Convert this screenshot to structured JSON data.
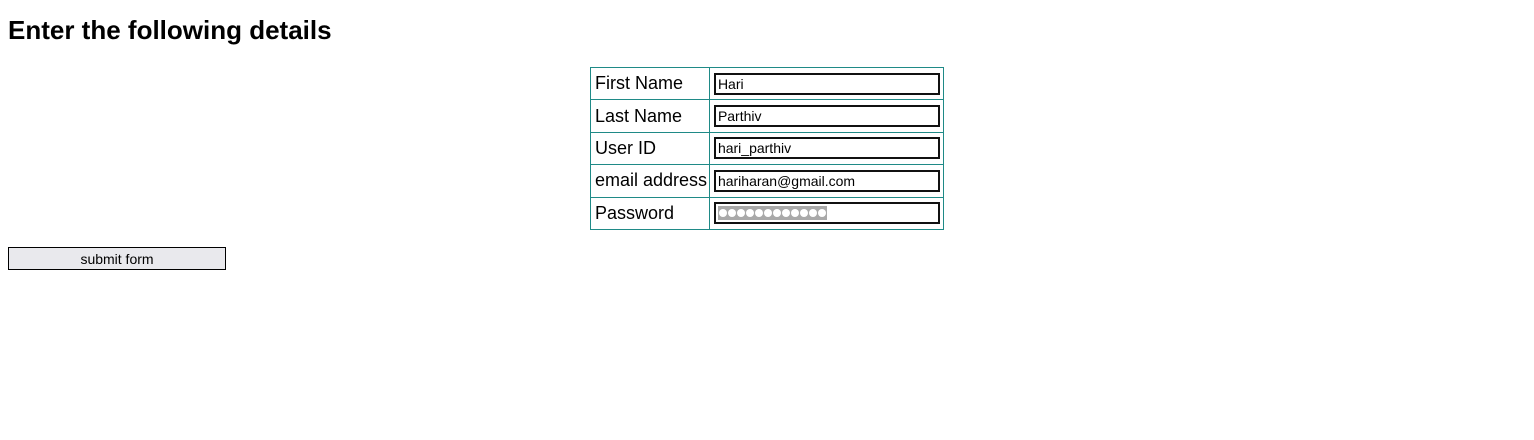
{
  "page": {
    "title": "Enter the following details"
  },
  "form": {
    "fields": [
      {
        "label": "First Name",
        "value": "Hari"
      },
      {
        "label": "Last Name",
        "value": "Parthiv"
      },
      {
        "label": "User ID",
        "value": "hari_parthiv"
      },
      {
        "label": "email address",
        "value": "hariharan@gmail.com"
      },
      {
        "label": "Password",
        "value": "",
        "masked_length": 12
      }
    ],
    "submit_label": "submit form"
  },
  "colors": {
    "table_border": "#1f8a87",
    "button_background": "#e9e9ed"
  }
}
